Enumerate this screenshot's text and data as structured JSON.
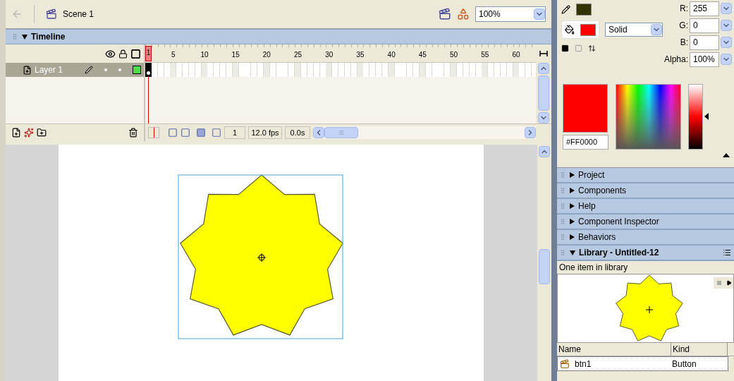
{
  "edit_bar": {
    "scene": "Scene 1",
    "zoom": "100%"
  },
  "timeline": {
    "title": "Timeline",
    "expanded": true,
    "frame_numbers": [
      "1",
      "5",
      "10",
      "15",
      "20",
      "25",
      "30",
      "35",
      "40",
      "45",
      "50",
      "55",
      "60"
    ],
    "layers": [
      {
        "name": "Layer 1",
        "selected": true
      }
    ],
    "current_frame": "1",
    "frame_rate": "12.0 fps",
    "elapsed": "0.0s"
  },
  "color_mixer": {
    "stroke": {
      "color": "#333300"
    },
    "fill": {
      "color": "#ff0000"
    },
    "fill_type": "Solid",
    "channels": [
      {
        "label": "R:",
        "value": "255"
      },
      {
        "label": "G:",
        "value": "0"
      },
      {
        "label": "B:",
        "value": "0"
      },
      {
        "label": "Alpha:",
        "value": "100%"
      }
    ],
    "hex": "#FF0000"
  },
  "panels": [
    {
      "title": "Project",
      "expanded": false
    },
    {
      "title": "Components",
      "expanded": false
    },
    {
      "title": "Help",
      "expanded": false
    },
    {
      "title": "Component Inspector",
      "expanded": false
    },
    {
      "title": "Behaviors",
      "expanded": false
    }
  ],
  "library": {
    "title": "Library - Untitled-12",
    "expanded": true,
    "summary": "One item in library",
    "columns": [
      "Name",
      "Kind"
    ],
    "items": [
      {
        "name": "btn1",
        "kind": "Button",
        "selected": true
      }
    ]
  }
}
